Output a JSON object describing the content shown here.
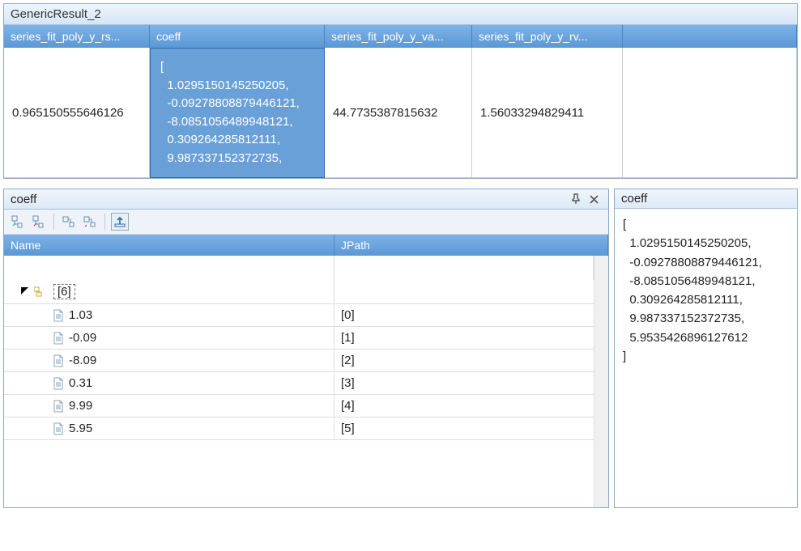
{
  "top": {
    "title": "GenericResult_2",
    "columns": [
      "series_fit_poly_y_rs...",
      "coeff",
      "series_fit_poly_y_va...",
      "series_fit_poly_y_rv..."
    ],
    "row": {
      "rs": "0.965150555646126",
      "coeff_display": "[\n  1.0295150145250205,\n  -0.09278808879446121,\n  -8.0851056489948121,\n  0.309264285812111,\n  9.987337152372735,",
      "va": "44.7735387815632",
      "rv": "1.56033294829411"
    }
  },
  "tree": {
    "title": "coeff",
    "headers": {
      "name": "Name",
      "jpath": "JPath"
    },
    "root_label": "[6]",
    "items": [
      {
        "value": "1.03",
        "jpath": "[0]"
      },
      {
        "value": "-0.09",
        "jpath": "[1]"
      },
      {
        "value": "-8.09",
        "jpath": "[2]"
      },
      {
        "value": "0.31",
        "jpath": "[3]"
      },
      {
        "value": "9.99",
        "jpath": "[4]"
      },
      {
        "value": "5.95",
        "jpath": "[5]"
      }
    ]
  },
  "detail": {
    "title": "coeff",
    "text": "[\n  1.0295150145250205,\n  -0.09278808879446121,\n  -8.0851056489948121,\n  0.309264285812111,\n  9.987337152372735,\n  5.9535426896127612\n]"
  }
}
